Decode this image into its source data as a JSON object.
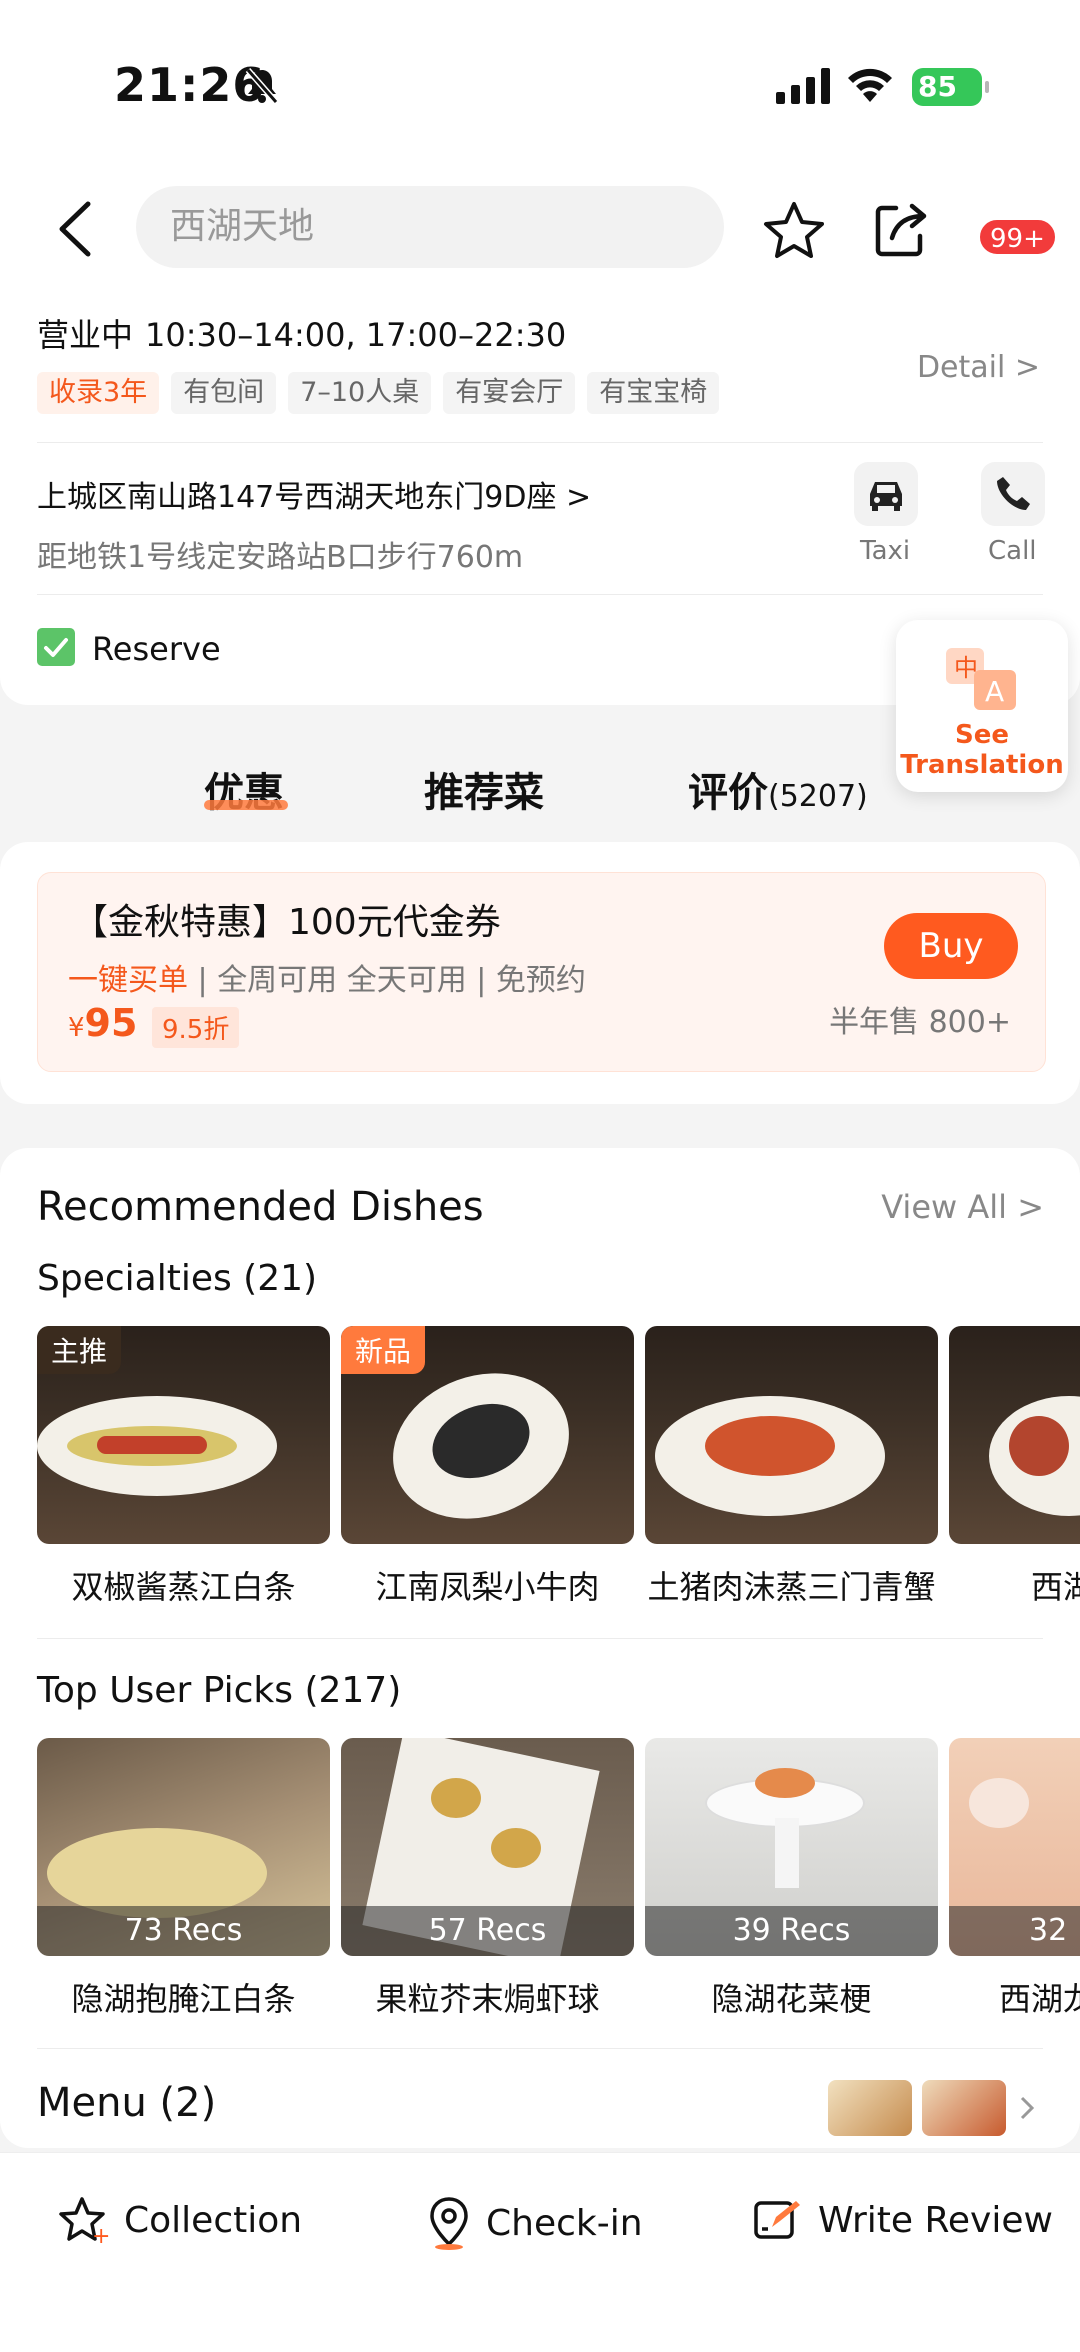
{
  "status_bar": {
    "time": "21:26",
    "battery": "85"
  },
  "nav": {
    "search_text": "西湖天地",
    "badge": "99+"
  },
  "info": {
    "status": "营业中",
    "hours": "10:30–14:00, 17:00–22:30",
    "tags": [
      "收录3年",
      "有包间",
      "7–10人桌",
      "有宴会厅",
      "有宝宝椅"
    ],
    "detail": "Detail >",
    "address": "上城区南山路147号西湖天地东门9D座 >",
    "metro": "距地铁1号线定安路站B口步行760m",
    "taxi": "Taxi",
    "call": "Call",
    "reserve": "Reserve"
  },
  "translation": {
    "line1": "See",
    "line2": "Translation"
  },
  "tabs": {
    "deals": "优惠",
    "dishes": "推荐菜",
    "reviews": "评价",
    "reviews_count": "(5207)"
  },
  "deal": {
    "title": "【金秋特惠】100元代金券",
    "one_click": "一键买单",
    "terms1": "全周可用 全天可用",
    "terms2": "免预约",
    "price": "95",
    "currency": "¥",
    "discount": "9.5折",
    "buy": "Buy",
    "sold": "半年售 800+"
  },
  "recommended": {
    "title": "Recommended Dishes",
    "view_all": "View All >",
    "specialties_title": "Specialties (21)",
    "specialties": [
      {
        "tag": "主推",
        "name": "双椒酱蒸江白条"
      },
      {
        "tag": "新品",
        "name": "江南凤梨小牛肉"
      },
      {
        "tag": "",
        "name": "土猪肉沫蒸三门青蟹"
      },
      {
        "tag": "",
        "name": "西湖"
      }
    ],
    "user_picks_title": "Top User Picks (217)",
    "user_picks": [
      {
        "recs": "73 Recs",
        "name": "隐湖抱腌江白条"
      },
      {
        "recs": "57 Recs",
        "name": "果粒芥末焗虾球"
      },
      {
        "recs": "39 Recs",
        "name": "隐湖花菜梗"
      },
      {
        "recs": "32",
        "name": "西湖龙"
      }
    ],
    "menu": "Menu (2)"
  },
  "bottom_bar": {
    "collection": "Collection",
    "checkin": "Check-in",
    "review": "Write Review"
  }
}
